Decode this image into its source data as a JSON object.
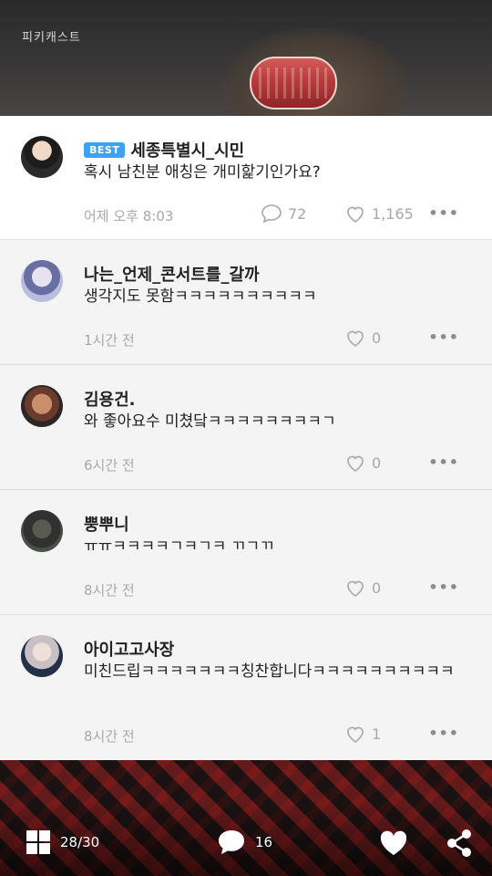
{
  "header": {
    "brand": "피키캐스트"
  },
  "best_comment": {
    "badge": "BEST",
    "author": "세종특별시_시민",
    "text": "혹시 남친분 애칭은 개미핥기인가요?",
    "time": "어제 오후 8:03",
    "replies": "72",
    "likes": "1,165",
    "more": "•••"
  },
  "comments": [
    {
      "author": "나는_언제_콘서트를_갈까",
      "text": "생각지도 못함ㅋㅋㅋㅋㅋㅋㅋㅋㅋㅋ",
      "time": "1시간 전",
      "likes": "0"
    },
    {
      "author": "김용건.",
      "text": "와 좋아요수 미쳤닼ㅋㅋㅋㅋㅋㅋㅋㅋㄱ",
      "time": "6시간 전",
      "likes": "0"
    },
    {
      "author": "뿡뿌니",
      "text": "ㅠㅠㅋㅋㅋㅋㄱㅋㄱㅋ ㄲㄱㄲ",
      "time": "8시간 전",
      "likes": "0"
    },
    {
      "author": "아이고고사장",
      "text": "미친드립ㅋㅋㅋㅋㅋㅋㅋ칭찬합니다ㅋㅋㅋㅋㅋㅋㅋㅋㅋㅋ",
      "time": "8시간 전",
      "likes": "1"
    }
  ],
  "bottom_bar": {
    "page": "28/30",
    "comment_count": "16"
  },
  "icons": {
    "grid": "grid-icon",
    "comment": "comment-icon",
    "heart": "heart-icon",
    "share": "share-icon"
  },
  "colors": {
    "badge": "#3da3f0",
    "muted": "#a8a8a8"
  }
}
